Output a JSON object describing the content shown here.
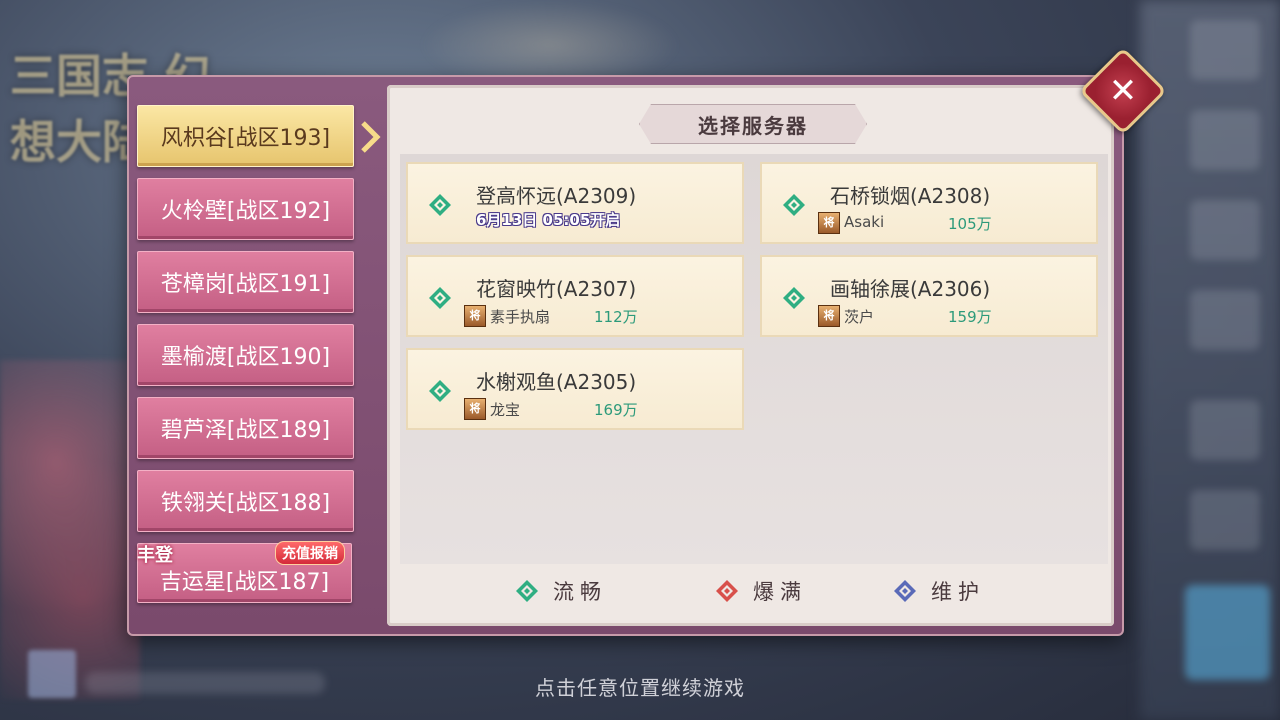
{
  "background": {
    "logo_text": "三国志 幻想大陆",
    "continue_hint": "点击任意位置继续游戏"
  },
  "panel": {
    "title": "选择服务器",
    "tabs": [
      {
        "label": "风枳谷[战区193]",
        "active": true
      },
      {
        "label": "火柃壁[战区192]",
        "active": false
      },
      {
        "label": "苍樟岗[战区191]",
        "active": false
      },
      {
        "label": "墨榆渡[战区190]",
        "active": false
      },
      {
        "label": "碧芦泽[战区189]",
        "active": false
      },
      {
        "label": "铁翎关[战区188]",
        "active": false
      },
      {
        "label": "吉运星[战区187]",
        "active": false
      }
    ],
    "tab_badges": {
      "left": "丰登",
      "right": "充值报销"
    },
    "servers": [
      {
        "name": "登高怀远(A2309)",
        "status": "smooth",
        "open_time": "6月13日 05:05开启"
      },
      {
        "name": "石桥锁烟(A2308)",
        "status": "smooth",
        "role_badge": "将",
        "role_name": "Asaki",
        "power": "105万"
      },
      {
        "name": "花窗映竹(A2307)",
        "status": "smooth",
        "role_badge": "将",
        "role_name": "素手执扇",
        "power": "112万"
      },
      {
        "name": "画轴徐展(A2306)",
        "status": "smooth",
        "role_badge": "将",
        "role_name": "茨户",
        "power": "159万"
      },
      {
        "name": "水榭观鱼(A2305)",
        "status": "smooth",
        "role_badge": "将",
        "role_name": "龙宝",
        "power": "169万"
      }
    ],
    "legend": [
      {
        "label": "流畅",
        "color": "#2fae82"
      },
      {
        "label": "爆满",
        "color": "#d8504a"
      },
      {
        "label": "维护",
        "color": "#5a6ab8"
      }
    ],
    "close_symbol": "✕"
  },
  "colors": {
    "status_smooth": "#2fae82",
    "status_full": "#d8504a",
    "status_maintenance": "#5a6ab8",
    "tab_active": "#fbe7a4",
    "tab_inactive": "#d86d93"
  }
}
